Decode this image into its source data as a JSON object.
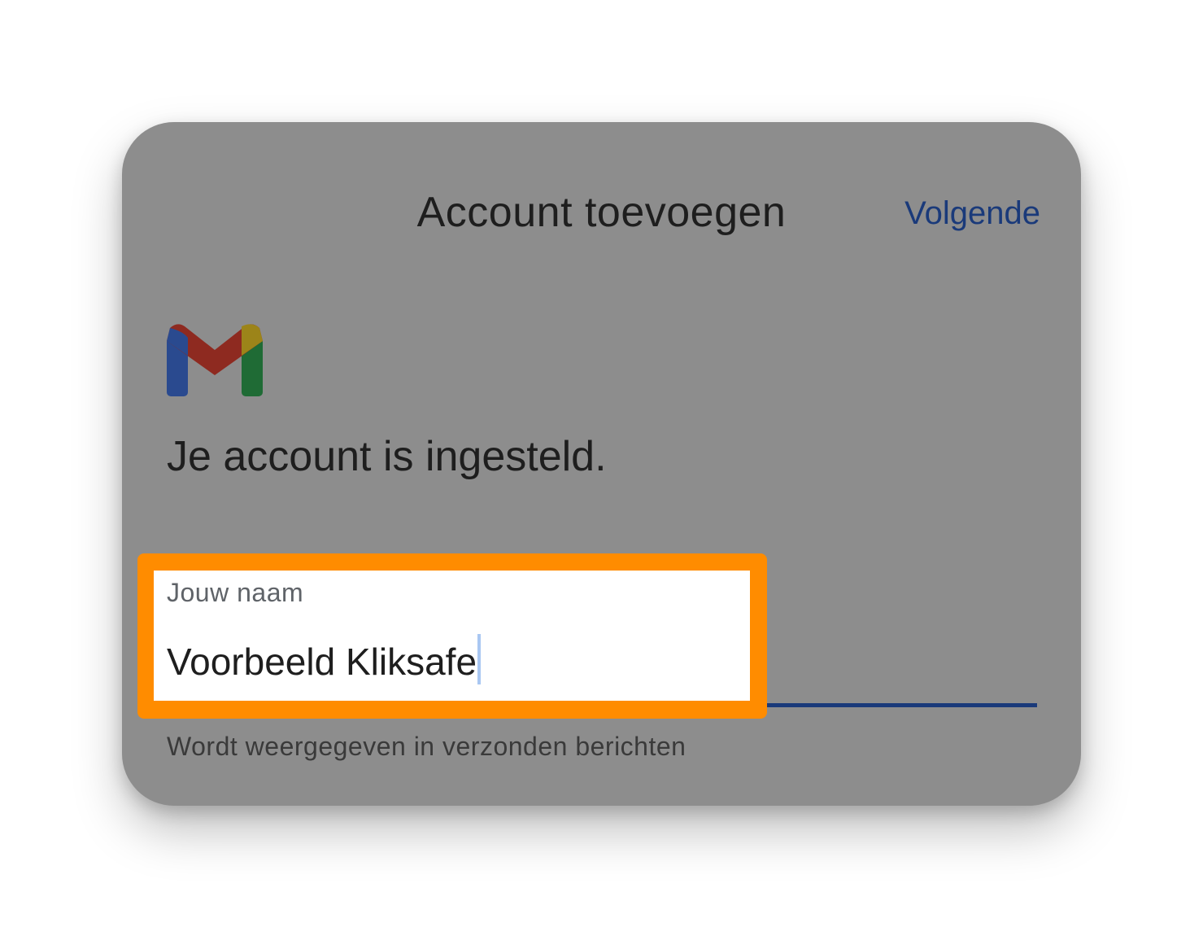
{
  "dialog": {
    "title": "Account toevoegen",
    "next_label": "Volgende",
    "logo_icon": "gmail-icon",
    "status_text": "Je account is ingesteld."
  },
  "name_field": {
    "label": "Jouw naam",
    "value": "Voorbeeld Kliksafe",
    "helper_text": "Wordt weergegeven in verzonden berichten"
  },
  "colors": {
    "highlight": "#ff8c00",
    "accent": "#1a3a7a",
    "overlay": "#8d8d8d"
  }
}
